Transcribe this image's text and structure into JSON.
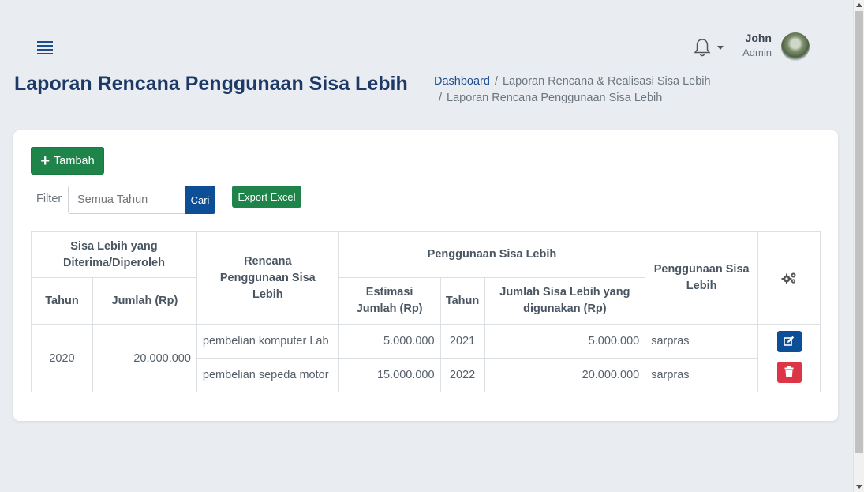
{
  "header": {
    "user_name": "John",
    "user_role": "Admin"
  },
  "page": {
    "title": "Laporan Rencana Penggunaan Sisa Lebih"
  },
  "breadcrumb": {
    "items": [
      "Dashboard",
      "Laporan Rencana & Realisasi Sisa Lebih",
      "Laporan Rencana Penggunaan Sisa Lebih"
    ]
  },
  "toolbar": {
    "add_label": "Tambah",
    "filter_label": "Filter",
    "filter_placeholder": "Semua Tahun",
    "search_label": "Cari",
    "export_label": "Export Excel"
  },
  "table": {
    "headers": {
      "group_received": "Sisa Lebih yang Diterima/Diperoleh",
      "tahun": "Tahun",
      "jumlah": "Jumlah (Rp)",
      "rencana": "Rencana Penggunaan Sisa Lebih",
      "group_usage": "Penggunaan Sisa Lebih",
      "estimasi": "Estimasi Jumlah (Rp)",
      "tahun2": "Tahun",
      "jumlah_digunakan": "Jumlah Sisa Lebih yang digunakan (Rp)",
      "penggunaan": "Penggunaan Sisa Lebih"
    },
    "group": {
      "tahun": "2020",
      "jumlah": "20.000.000"
    },
    "rows": [
      {
        "rencana": "pembelian komputer Lab",
        "estimasi": "5.000.000",
        "tahun": "2021",
        "jumlah_digunakan": "5.000.000",
        "penggunaan": "sarpras"
      },
      {
        "rencana": "pembelian sepeda motor",
        "estimasi": "15.000.000",
        "tahun": "2022",
        "jumlah_digunakan": "20.000.000",
        "penggunaan": "sarpras"
      }
    ]
  },
  "colors": {
    "primary": "#0d4f96",
    "success": "#1e8449",
    "danger": "#dc3545",
    "title": "#1d3a66"
  }
}
